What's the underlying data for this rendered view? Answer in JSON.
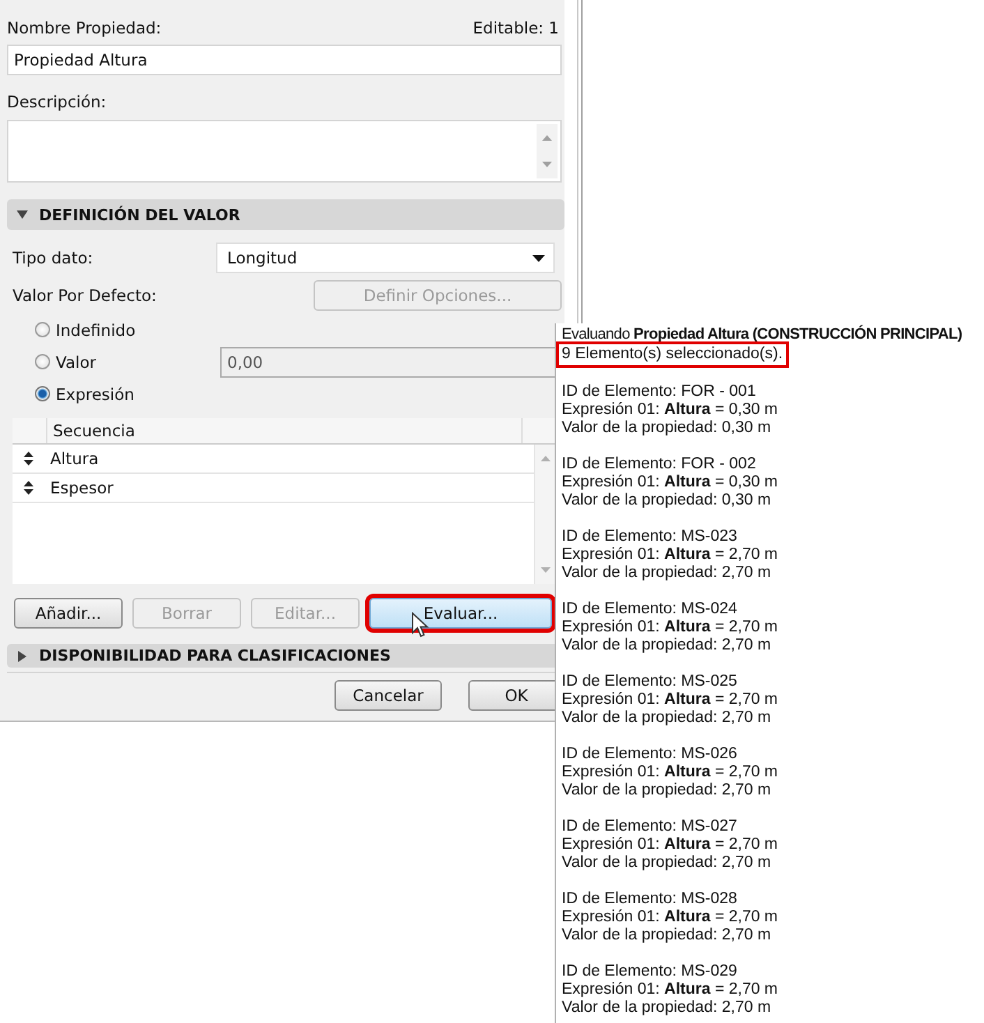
{
  "dialog": {
    "name_label": "Nombre Propiedad:",
    "editable": "Editable: 1",
    "name_value": "Propiedad Altura",
    "description_label": "Descripción:",
    "sections": [
      {
        "title": "DEFINICIÓN DEL VALOR",
        "expanded": true
      },
      {
        "title": "DISPONIBILIDAD PARA CLASIFICACIONES",
        "expanded": false
      }
    ],
    "data_type_label": "Tipo dato:",
    "data_type": "Longitud",
    "default_label": "Valor Por Defecto:",
    "options_button": {
      "label": "Definir Opciones...",
      "disabled": true
    },
    "radios": [
      {
        "label": "Indefinido",
        "selected": false
      },
      {
        "label": "Valor",
        "selected": false
      },
      {
        "label": "Expresión",
        "selected": true
      }
    ],
    "value_field": {
      "value": "0,00",
      "disabled": true
    },
    "table": {
      "columns": [
        "Secuencia"
      ],
      "rows": [
        {
          "label": "Altura"
        },
        {
          "label": "Espesor"
        }
      ]
    },
    "actions": [
      {
        "label": "Añadir...",
        "disabled": false,
        "highlighted": false,
        "hovered": false
      },
      {
        "label": "Borrar",
        "disabled": true,
        "highlighted": false,
        "hovered": false
      },
      {
        "label": "Editar...",
        "disabled": true,
        "highlighted": false,
        "hovered": false
      },
      {
        "label": "Evaluar...",
        "disabled": false,
        "highlighted": true,
        "hovered": true
      }
    ],
    "footer_buttons": [
      "Cancelar",
      "OK"
    ]
  },
  "popup": {
    "title": "Evaluando **Propiedad Altura (CONSTRUCCIÓN PRINCIPAL)**",
    "count": {
      "text": "9 Elemento(s) seleccionado(s).",
      "highlighted": true
    },
    "elements": [
      {
        "id": "ID de Elemento: FOR - 001",
        "expression": "Expresión 01: **Altura** = 0,30 m",
        "value": "Valor de la propiedad: 0,30 m"
      },
      {
        "id": "ID de Elemento: FOR - 002",
        "expression": "Expresión 01: **Altura** = 0,30 m",
        "value": "Valor de la propiedad: 0,30 m"
      },
      {
        "id": "ID de Elemento: MS-023",
        "expression": "Expresión 01: **Altura** = 2,70 m",
        "value": "Valor de la propiedad: 2,70 m"
      },
      {
        "id": "ID de Elemento: MS-024",
        "expression": "Expresión 01: **Altura** = 2,70 m",
        "value": "Valor de la propiedad: 2,70 m"
      },
      {
        "id": "ID de Elemento: MS-025",
        "expression": "Expresión 01: **Altura** = 2,70 m",
        "value": "Valor de la propiedad: 2,70 m"
      },
      {
        "id": "ID de Elemento: MS-026",
        "expression": "Expresión 01: **Altura** = 2,70 m",
        "value": "Valor de la propiedad: 2,70 m"
      },
      {
        "id": "ID de Elemento: MS-027",
        "expression": "Expresión 01: **Altura** = 2,70 m",
        "value": "Valor de la propiedad: 2,70 m"
      },
      {
        "id": "ID de Elemento: MS-028",
        "expression": "Expresión 01: **Altura** = 2,70 m",
        "value": "Valor de la propiedad: 2,70 m"
      },
      {
        "id": "ID de Elemento: MS-029",
        "expression": "Expresión 01: **Altura** = 2,70 m",
        "value": "Valor de la propiedad: 2,70 m"
      }
    ]
  }
}
